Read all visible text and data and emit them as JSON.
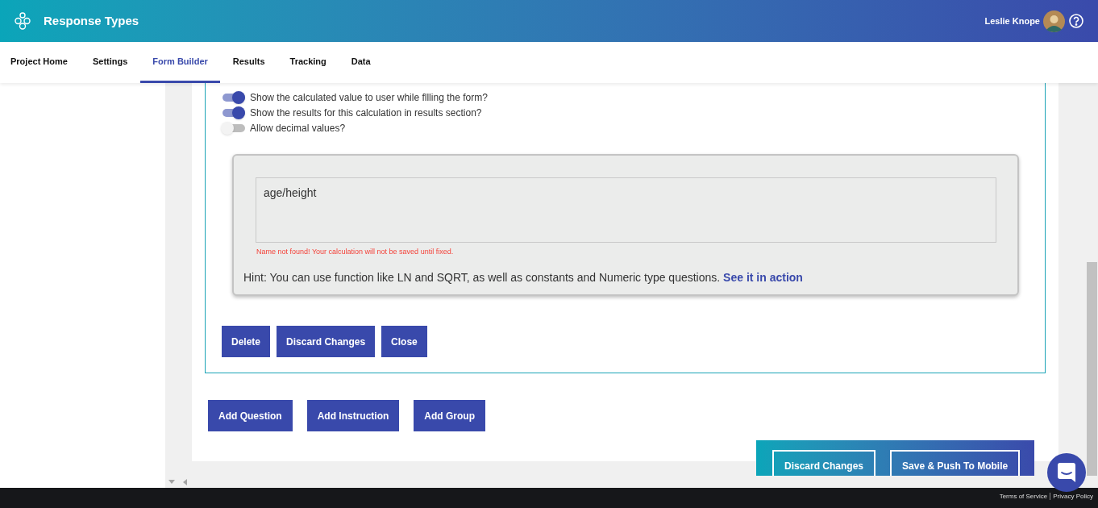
{
  "header": {
    "title": "Response Types",
    "user_name": "Leslie Knope"
  },
  "tabs": [
    {
      "label": "Project Home",
      "selected": false
    },
    {
      "label": "Settings",
      "selected": false
    },
    {
      "label": "Form Builder",
      "selected": true
    },
    {
      "label": "Results",
      "selected": false
    },
    {
      "label": "Tracking",
      "selected": false
    },
    {
      "label": "Data",
      "selected": false
    }
  ],
  "toggles": [
    {
      "label": "Show the calculated value to user while fllling the form?",
      "on": true
    },
    {
      "label": "Show the results for this calculation in results section?",
      "on": true
    },
    {
      "label": "Allow decimal values?",
      "on": false
    }
  ],
  "calculation": {
    "value": "age/height",
    "error": "Name not found! Your calculation will not be saved until fixed.",
    "hint": "Hint: You can use function like LN and SQRT, as well as constants and Numeric type questions.",
    "hint_link": "See it in action"
  },
  "editor_buttons": [
    "Delete",
    "Discard Changes",
    "Close"
  ],
  "add_buttons": [
    "Add Question",
    "Add Instruction",
    "Add Group"
  ],
  "action_bar": {
    "buttons": [
      "Discard Changes",
      "Save & Push To Mobile"
    ]
  },
  "footer": {
    "links": [
      "Terms of Service",
      "Privacy Policy"
    ]
  }
}
